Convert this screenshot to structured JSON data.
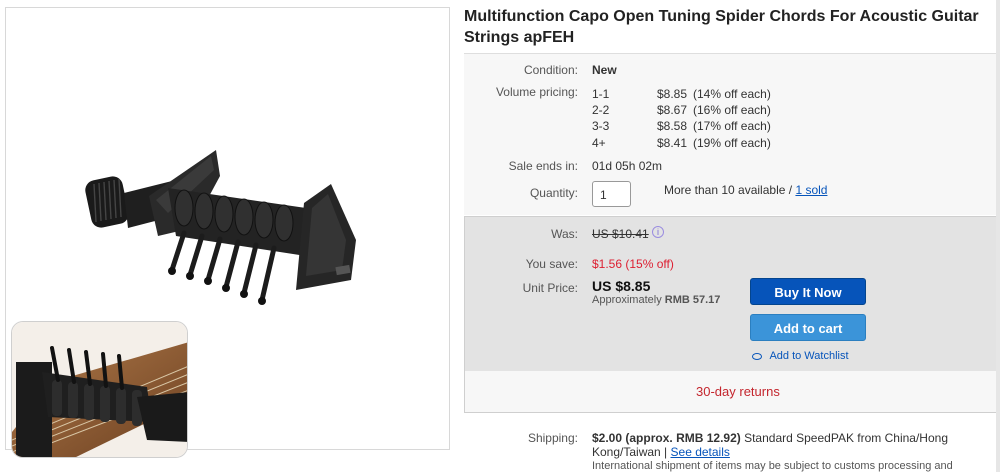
{
  "title": "Multifunction Capo Open Tuning Spider Chords For Acoustic Guitar Strings apFEH",
  "condition": {
    "label": "Condition:",
    "value": "New"
  },
  "volume_pricing": {
    "label": "Volume pricing:",
    "rows": [
      {
        "qty": "1-1",
        "price": "$8.85",
        "off": "(14% off each)"
      },
      {
        "qty": "2-2",
        "price": "$8.67",
        "off": "(16% off each)"
      },
      {
        "qty": "3-3",
        "price": "$8.58",
        "off": "(17% off each)"
      },
      {
        "qty": "4+",
        "price": "$8.41",
        "off": "(19% off each)"
      }
    ]
  },
  "sale_ends": {
    "label": "Sale ends in:",
    "value": "01d 05h 02m"
  },
  "quantity": {
    "label": "Quantity:",
    "value": "1",
    "available": "More than 10 available /",
    "sold": "1 sold"
  },
  "price": {
    "was_label": "Was:",
    "was_value": "US $10.41",
    "save_label": "You save:",
    "save_value": "$1.56 (15% off)",
    "unit_label": "Unit Price:",
    "unit_value": "US $8.85",
    "approx_prefix": "Approximately",
    "approx_value": "RMB 57.17"
  },
  "buttons": {
    "buy_now": "Buy It Now",
    "add_to_cart": "Add to cart",
    "watchlist": "Add to Watchlist"
  },
  "returns": "30-day returns",
  "shipping": {
    "label": "Shipping:",
    "cost": "$2.00",
    "approx": "(approx.",
    "approx_rmb": "RMB 12.92)",
    "method": "Standard SpeedPAK from China/Hong Kong/Taiwan |",
    "see_details": "See details",
    "note": "International shipment of items may be subject to customs processing and additional"
  },
  "colors": {
    "buy_button": "#0654ba",
    "cart_button": "#3b94d9",
    "save_red": "#dd1e31",
    "returns_red": "#c4262e",
    "link_blue": "#0654ba"
  },
  "icons": {
    "info": "info-icon",
    "watch": "eye-icon"
  }
}
